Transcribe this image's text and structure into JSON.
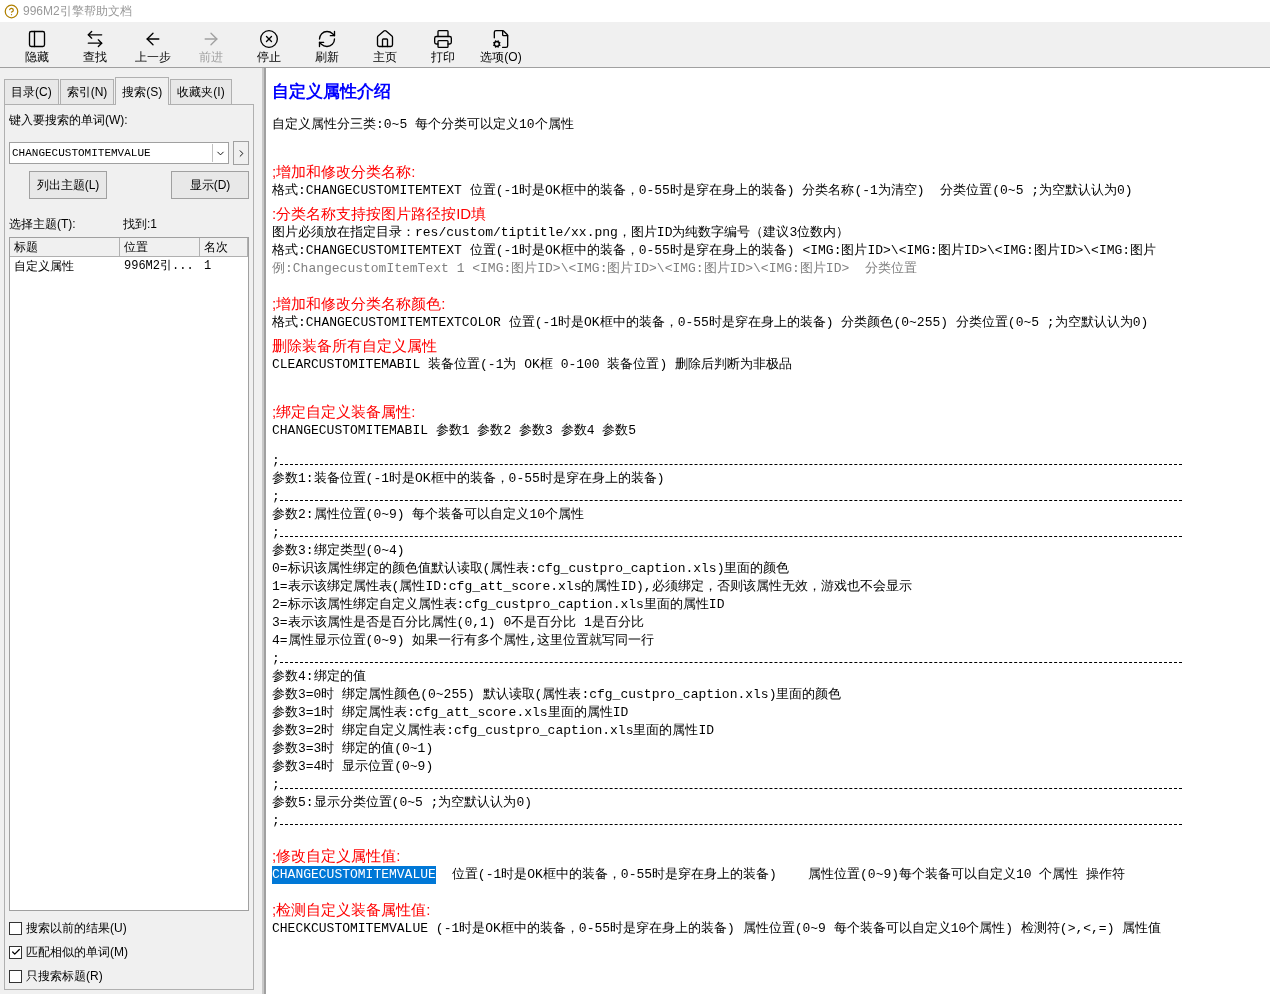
{
  "window": {
    "title": "996M2引擎帮助文档"
  },
  "toolbar": [
    {
      "label": "隐藏",
      "disabled": false
    },
    {
      "label": "查找",
      "disabled": false
    },
    {
      "label": "上一步",
      "disabled": false
    },
    {
      "label": "前进",
      "disabled": true
    },
    {
      "label": "停止",
      "disabled": false
    },
    {
      "label": "刷新",
      "disabled": false
    },
    {
      "label": "主页",
      "disabled": false
    },
    {
      "label": "打印",
      "disabled": false
    },
    {
      "label": "选项(O)",
      "disabled": false
    }
  ],
  "sidebar": {
    "tabs": [
      {
        "label": "目录(C)",
        "selected": false
      },
      {
        "label": "索引(N)",
        "selected": false
      },
      {
        "label": "搜索(S)",
        "selected": true
      },
      {
        "label": "收藏夹(I)",
        "selected": false
      }
    ],
    "search_label": "键入要搜索的单词(W):",
    "search": {
      "value": "CHANGECUSTOMITEMVALUE"
    },
    "buttons": [
      "列出主题(L)",
      "显示(D)"
    ],
    "topics_label": "选择主题(T):",
    "found": "找到:1",
    "table": {
      "columns": [
        "标题",
        "位置",
        "名次"
      ],
      "rows": [
        {
          "cells": [
            "自定义属性",
            "996M2引...",
            "1"
          ],
          "selected": false
        }
      ]
    },
    "options": [
      {
        "label": "搜索以前的结果(U)",
        "checked": false
      },
      {
        "label": "匹配相似的单词(M)",
        "checked": true
      },
      {
        "label": "只搜索标题(R)",
        "checked": false
      }
    ]
  },
  "content": [
    {
      "kind": "heading",
      "text": "自定义属性介绍"
    },
    {
      "kind": "text",
      "text": "自定义属性分三类:0~5 每个分类可以定义10个属性"
    },
    {
      "kind": "blank"
    },
    {
      "kind": "blank"
    },
    {
      "kind": "red",
      "text": ";增加和修改分类名称:"
    },
    {
      "kind": "text",
      "text": "格式:CHANGECUSTOMITEMTEXT 位置(-1时是OK框中的装备，0-55时是穿在身上的装备) 分类名称(-1为清空)  分类位置(0~5 ;为空默认认为0)"
    },
    {
      "kind": "red",
      "text": ":分类名称支持按图片路径按ID填"
    },
    {
      "kind": "text",
      "text": "图片必须放在指定目录：res/custom/tiptitle/xx.png，图片ID为纯数字编号（建议3位数内）"
    },
    {
      "kind": "text",
      "text": "格式:CHANGECUSTOMITEMTEXT 位置(-1时是OK框中的装备，0-55时是穿在身上的装备) <IMG:图片ID>\\<IMG:图片ID>\\<IMG:图片ID>\\<IMG:图片"
    },
    {
      "kind": "gray",
      "text": "例:ChangecustomItemText 1 <IMG:图片ID>\\<IMG:图片ID>\\<IMG:图片ID>\\<IMG:图片ID>  分类位置"
    },
    {
      "kind": "blank"
    },
    {
      "kind": "red",
      "text": ";增加和修改分类名称颜色:"
    },
    {
      "kind": "text",
      "text": "格式:CHANGECUSTOMITEMTEXTCOLOR 位置(-1时是OK框中的装备，0-55时是穿在身上的装备) 分类颜色(0~255) 分类位置(0~5 ;为空默认认为0)"
    },
    {
      "kind": "red",
      "text": "删除装备所有自定义属性"
    },
    {
      "kind": "text",
      "text": "CLEARCUSTOMITEMABIL 装备位置(-1为 OK框 0-100 装备位置) 删除后判断为非极品"
    },
    {
      "kind": "blank"
    },
    {
      "kind": "blank"
    },
    {
      "kind": "red",
      "text": ";绑定自定义装备属性:"
    },
    {
      "kind": "text",
      "text": "CHANGECUSTOMITEMABIL 参数1 参数2 参数3 参数4 参数5"
    },
    {
      "kind": "blank"
    },
    {
      "kind": "separator",
      "text": ";"
    },
    {
      "kind": "text",
      "text": "参数1:装备位置(-1时是OK框中的装备，0-55时是穿在身上的装备)"
    },
    {
      "kind": "separator",
      "text": ";"
    },
    {
      "kind": "text",
      "text": "参数2:属性位置(0~9) 每个装备可以自定义10个属性"
    },
    {
      "kind": "separator",
      "text": ";"
    },
    {
      "kind": "text",
      "text": "参数3:绑定类型(0~4)"
    },
    {
      "kind": "text",
      "text": "0=标识该属性绑定的颜色值默认读取(属性表:cfg_custpro_caption.xls)里面的颜色"
    },
    {
      "kind": "text",
      "text": "1=表示该绑定属性表(属性ID:cfg_att_score.xls的属性ID),必须绑定，否则该属性无效，游戏也不会显示"
    },
    {
      "kind": "text",
      "text": "2=标示该属性绑定自定义属性表:cfg_custpro_caption.xls里面的属性ID"
    },
    {
      "kind": "text",
      "text": "3=表示该属性是否是百分比属性(0,1) 0不是百分比 1是百分比"
    },
    {
      "kind": "text",
      "text": "4=属性显示位置(0~9) 如果一行有多个属性,这里位置就写同一行"
    },
    {
      "kind": "separator",
      "text": ";"
    },
    {
      "kind": "text",
      "text": "参数4:绑定的值"
    },
    {
      "kind": "text",
      "text": "参数3=0时 绑定属性颜色(0~255) 默认读取(属性表:cfg_custpro_caption.xls)里面的颜色"
    },
    {
      "kind": "text",
      "text": "参数3=1时 绑定属性表:cfg_att_score.xls里面的属性ID"
    },
    {
      "kind": "text",
      "text": "参数3=2时 绑定自定义属性表:cfg_custpro_caption.xls里面的属性ID"
    },
    {
      "kind": "text",
      "text": "参数3=3时 绑定的值(0~1)"
    },
    {
      "kind": "text",
      "text": "参数3=4时 显示位置(0~9)"
    },
    {
      "kind": "separator",
      "text": ";"
    },
    {
      "kind": "text",
      "text": "参数5:显示分类位置(0~5 ;为空默认认为0)"
    },
    {
      "kind": "separator",
      "text": ";"
    },
    {
      "kind": "blank"
    },
    {
      "kind": "red",
      "text": ";修改自定义属性值:"
    },
    {
      "kind": "highlight",
      "highlight": "CHANGECUSTOMITEMVALUE",
      "text": "位置(-1时是OK框中的装备，0-55时是穿在身上的装备)    属性位置(0~9)每个装备可以自定义10 个属性 操作符"
    },
    {
      "kind": "blank"
    },
    {
      "kind": "red",
      "text": ";检测自定义装备属性值:"
    },
    {
      "kind": "text",
      "text": "CHECKCUSTOMITEMVALUE (-1时是OK框中的装备，0-55时是穿在身上的装备) 属性位置(0~9 每个装备可以自定义10个属性) 检测符(>,<,=) 属性值"
    }
  ]
}
